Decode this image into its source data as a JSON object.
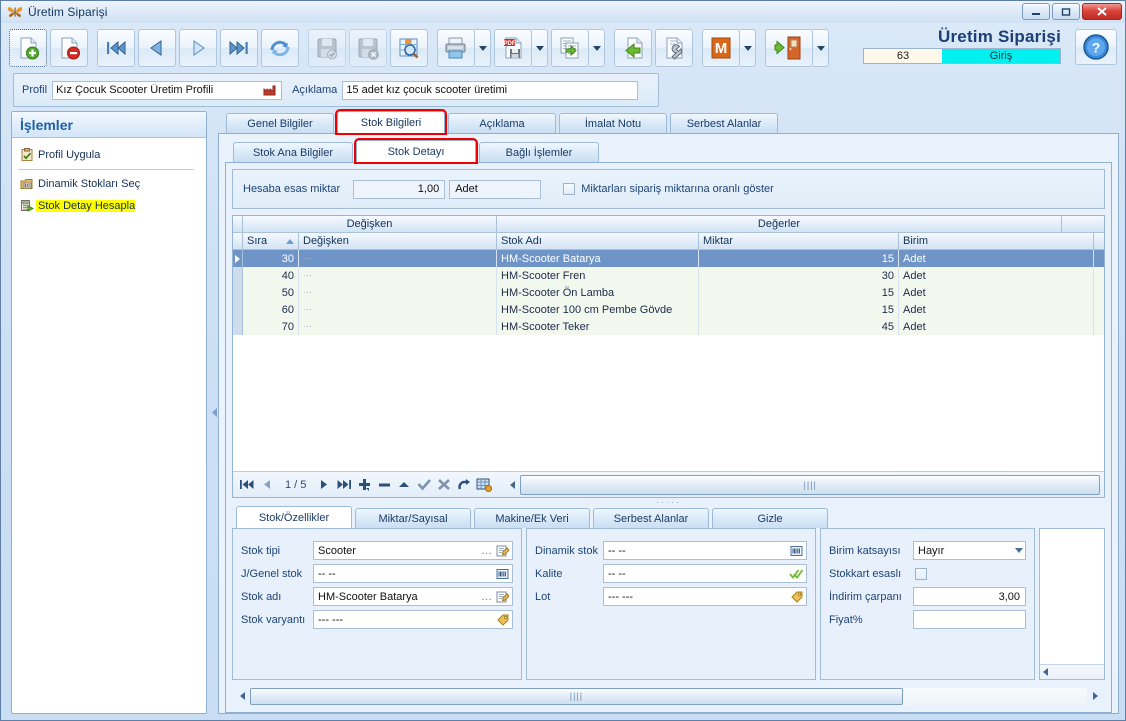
{
  "window": {
    "title": "Üretim Siparişi",
    "app_icon": "butterfly-icon",
    "minimize": "—",
    "maximize": "▫",
    "close": "✕"
  },
  "toolbar": {
    "buttons": [
      {
        "name": "new-record-button",
        "icon": "new-document-icon"
      },
      {
        "name": "delete-record-button",
        "icon": "delete-document-icon"
      },
      {
        "name": "first-record-button",
        "icon": "first-icon"
      },
      {
        "name": "previous-record-button",
        "icon": "previous-icon"
      },
      {
        "name": "next-record-button",
        "icon": "next-icon"
      },
      {
        "name": "last-record-button",
        "icon": "last-icon"
      },
      {
        "name": "refresh-button",
        "icon": "refresh-icon"
      },
      {
        "name": "save-button",
        "icon": "save-icon"
      },
      {
        "name": "save-close-button",
        "icon": "save-cancel-icon"
      },
      {
        "name": "query-button",
        "icon": "table-search-icon"
      },
      {
        "name": "print-button",
        "icon": "printer-icon"
      },
      {
        "name": "export-pdf-button",
        "icon": "pdf-save-icon"
      },
      {
        "name": "copy-button",
        "icon": "copy-document-icon"
      },
      {
        "name": "back-button",
        "icon": "back-arrow-icon"
      },
      {
        "name": "tools-button",
        "icon": "wrench-document-icon"
      },
      {
        "name": "macro-button",
        "icon": "m-letter-icon"
      },
      {
        "name": "exit-button",
        "icon": "exit-door-icon"
      }
    ],
    "help": "help-icon"
  },
  "status": {
    "title": "Üretim Siparişi",
    "number": "63",
    "mode": "Giriş",
    "number_bg": "#fdf8ea",
    "mode_bg": "#00f0f0"
  },
  "profile_bar": {
    "profil_label": "Profil",
    "profil_value": "Kız Çocuk Scooter Üretim Profili",
    "profil_icon": "factory-icon",
    "aciklama_label": "Açıklama",
    "aciklama_value": "15 adet kız çocuk scooter üretimi"
  },
  "sidebar": {
    "title": "İşlemler",
    "items": [
      {
        "label": "Profil Uygula",
        "icon": "clipboard-check-icon",
        "highlighted": false
      },
      {
        "label": "Dinamik Stokları Seç",
        "icon": "stock-select-icon",
        "highlighted": false
      },
      {
        "label": "Stok Detay Hesapla",
        "icon": "calculate-icon",
        "highlighted": true
      }
    ]
  },
  "tabs": {
    "main": [
      {
        "label": "Genel Bilgiler",
        "active": false,
        "boxed": false
      },
      {
        "label": "Stok Bilgileri",
        "active": true,
        "boxed": true
      },
      {
        "label": "Açıklama",
        "active": false,
        "boxed": false
      },
      {
        "label": "İmalat Notu",
        "active": false,
        "boxed": false
      },
      {
        "label": "Serbest Alanlar",
        "active": false,
        "boxed": false
      }
    ],
    "sub": [
      {
        "label": "Stok Ana Bilgiler",
        "active": false,
        "boxed": false
      },
      {
        "label": "Stok Detayı",
        "active": true,
        "boxed": true
      },
      {
        "label": "Bağlı İşlemler",
        "active": false,
        "boxed": false
      }
    ],
    "detail": [
      {
        "label": "Stok/Özellikler",
        "active": true
      },
      {
        "label": "Miktar/Sayısal",
        "active": false
      },
      {
        "label": "Makine/Ek Veri",
        "active": false
      },
      {
        "label": "Serbest Alanlar",
        "active": false
      },
      {
        "label": "Gizle",
        "active": false
      }
    ]
  },
  "quantity_box": {
    "label": "Hesaba esas miktar",
    "amount": "1,00",
    "unit": "Adet",
    "checkbox_label": "Miktarları sipariş miktarına oranlı göster",
    "checkbox_checked": false
  },
  "grid": {
    "bands": [
      {
        "label": "Değişken"
      },
      {
        "label": "Değerler"
      }
    ],
    "columns": [
      "Sıra",
      "Değişken",
      "Stok Adı",
      "Miktar",
      "Birim"
    ],
    "sort_column": "Sıra",
    "sort_direction": "asc",
    "rows": [
      {
        "sira": "30",
        "degisken": "",
        "stok_adi": "HM-Scooter Batarya",
        "miktar": "15",
        "birim": "Adet",
        "selected": true
      },
      {
        "sira": "40",
        "degisken": "",
        "stok_adi": "HM-Scooter Fren",
        "miktar": "30",
        "birim": "Adet",
        "selected": false
      },
      {
        "sira": "50",
        "degisken": "",
        "stok_adi": "HM-Scooter Ön Lamba",
        "miktar": "15",
        "birim": "Adet",
        "selected": false
      },
      {
        "sira": "60",
        "degisken": "",
        "stok_adi": "HM-Scooter 100 cm Pembe Gövde",
        "miktar": "15",
        "birim": "Adet",
        "selected": false
      },
      {
        "sira": "70",
        "degisken": "",
        "stok_adi": "HM-Scooter Teker",
        "miktar": "45",
        "birim": "Adet",
        "selected": false
      }
    ]
  },
  "grid_nav": {
    "page_indicator": "1 / 5",
    "buttons": [
      {
        "name": "nav-first-button",
        "icon": "first-icon"
      },
      {
        "name": "nav-prev-button",
        "icon": "previous-icon"
      },
      {
        "name": "nav-next-button",
        "icon": "next-icon"
      },
      {
        "name": "nav-last-button",
        "icon": "last-icon"
      },
      {
        "name": "nav-add-button",
        "icon": "plus-icon"
      },
      {
        "name": "nav-remove-button",
        "icon": "minus-icon"
      },
      {
        "name": "nav-edit-button",
        "icon": "up-caret-icon"
      },
      {
        "name": "nav-confirm-button",
        "icon": "check-icon"
      },
      {
        "name": "nav-cancel-button",
        "icon": "x-icon"
      },
      {
        "name": "nav-undo-button",
        "icon": "undo-icon"
      },
      {
        "name": "nav-settings-button",
        "icon": "grid-settings-icon"
      }
    ]
  },
  "detail": {
    "left_fields": [
      {
        "label": "Stok tipi",
        "value": "Scooter",
        "dots": "…",
        "icon": "edit-note-icon"
      },
      {
        "label": "J/Genel stok",
        "value": "-- --",
        "dots": "",
        "icon": "barcode-icon"
      },
      {
        "label": "Stok adı",
        "value": "HM-Scooter Batarya",
        "dots": "…",
        "icon": "edit-note-icon"
      },
      {
        "label": "Stok varyantı",
        "value": "--- ---",
        "dots": "",
        "icon": "tag-icon"
      }
    ],
    "middle_fields": [
      {
        "label": "Dinamik stok",
        "value": "-- --",
        "dots": "",
        "icon": "barcode-icon"
      },
      {
        "label": "Kalite",
        "value": "-- --",
        "dots": "",
        "icon": "double-check-icon"
      },
      {
        "label": "Lot",
        "value": "--- ---",
        "dots": "",
        "icon": "tag-icon"
      }
    ],
    "right_fields": [
      {
        "label": "Birim katsayısı",
        "type": "select",
        "value": "Hayır"
      },
      {
        "label": "Stokkart esaslı",
        "type": "checkbox",
        "value": "",
        "checked": false
      },
      {
        "label": "İndirim çarpanı",
        "type": "number",
        "value": "3,00"
      },
      {
        "label": "Fiyat%",
        "type": "number",
        "value": ""
      }
    ]
  },
  "scrollbars": {
    "grid_h_grip": "||||",
    "bottom_grip": "||||",
    "left_arrow": "◀",
    "right_arrow": "▶"
  },
  "colors": {
    "accent": "#1c3f75",
    "highlight": "#ffff00",
    "selection": "#6f94c8",
    "tab_box": "#ee0000",
    "status_mode": "#00f0f0"
  }
}
